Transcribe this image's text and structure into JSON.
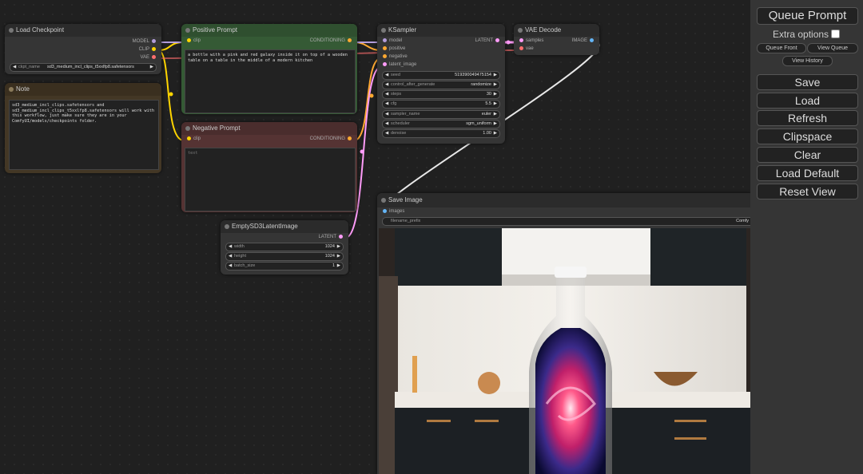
{
  "nodes": {
    "load_checkpoint": {
      "title": "Load Checkpoint",
      "outputs": [
        "MODEL",
        "CLIP",
        "VAE"
      ],
      "widget_label": "ckpt_name",
      "widget_value": "sd3_medium_incl_clips_t5xxlfp8.safetensors"
    },
    "note": {
      "title": "Note",
      "text": "sd3_medium_incl_clips.safetensors and\nsd3_medium_incl_clips_t5xxlfp8.safetensors will work with\nthis workflow, just make sure they are in your\nComfyUI/models/checkpoints folder."
    },
    "positive_prompt": {
      "title": "Positive Prompt",
      "input": "clip",
      "output": "CONDITIONING",
      "text": "a bottle with a pink and red galaxy inside it on top of a wooden\ntable on a table in the middle of a modern kitchen"
    },
    "negative_prompt": {
      "title": "Negative Prompt",
      "input": "clip",
      "output": "CONDITIONING",
      "placeholder": "text"
    },
    "ksampler": {
      "title": "KSampler",
      "inputs": [
        "model",
        "positive",
        "negative",
        "latent_image"
      ],
      "output": "LATENT",
      "widgets": [
        {
          "label": "seed",
          "value": "519390049475154"
        },
        {
          "label": "control_after_generate",
          "value": "randomize"
        },
        {
          "label": "steps",
          "value": "30"
        },
        {
          "label": "cfg",
          "value": "5.5"
        },
        {
          "label": "sampler_name",
          "value": "euler"
        },
        {
          "label": "scheduler",
          "value": "sgm_uniform"
        },
        {
          "label": "denoise",
          "value": "1.00"
        }
      ]
    },
    "vae_decode": {
      "title": "VAE Decode",
      "inputs": [
        "samples",
        "vae"
      ],
      "output": "IMAGE"
    },
    "empty_latent": {
      "title": "EmptySD3LatentImage",
      "output": "LATENT",
      "widgets": [
        {
          "label": "width",
          "value": "1024"
        },
        {
          "label": "height",
          "value": "1024"
        },
        {
          "label": "batch_size",
          "value": "1"
        }
      ]
    },
    "save_image": {
      "title": "Save Image",
      "input": "images",
      "widget_label": "filename_prefix",
      "widget_value": "Comfy"
    }
  },
  "menu": {
    "queue_prompt": "Queue Prompt",
    "extra_options": "Extra options",
    "queue_front": "Queue Front",
    "view_queue": "View Queue",
    "view_history": "View History",
    "save": "Save",
    "load": "Load",
    "refresh": "Refresh",
    "clipspace": "Clipspace",
    "clear": "Clear",
    "load_default": "Load Default",
    "reset_view": "Reset View"
  },
  "colors": {
    "model": "#b39ddb",
    "clip": "#ffd500",
    "vae": "#ff6e6e",
    "conditioning": "#ffa931",
    "latent": "#ff9cf9",
    "image": "#64b5f6",
    "positive_node": "#2a3a2a",
    "negative_node": "#3a2a2a",
    "note_node": "#433725"
  }
}
